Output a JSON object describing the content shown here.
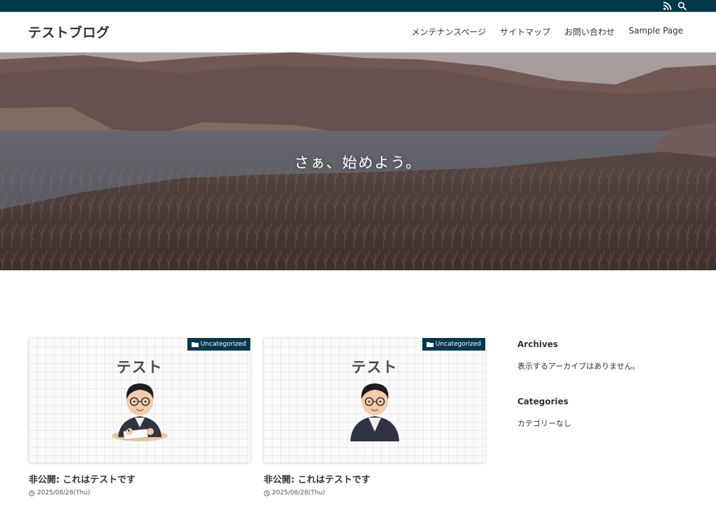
{
  "site": {
    "title": "テストブログ"
  },
  "nav": [
    {
      "label": "メンテナンスページ"
    },
    {
      "label": "サイトマップ"
    },
    {
      "label": "お問い合わせ"
    },
    {
      "label": "Sample Page"
    }
  ],
  "topbar": {
    "icons": [
      "rss-icon",
      "search-icon"
    ]
  },
  "hero": {
    "catch": "さぁ、始めよう。"
  },
  "posts": [
    {
      "category": "Uncategorized",
      "thumb_text": "テスト",
      "title": "非公開: これはテストです",
      "date": "2025/08/28(Thu)"
    },
    {
      "category": "Uncategorized",
      "thumb_text": "テスト",
      "title": "非公開: これはテストです",
      "date": "2025/08/28(Thu)"
    }
  ],
  "sidebar": {
    "archives": {
      "title": "Archives",
      "text": "表示するアーカイブはありません。"
    },
    "categories": {
      "title": "Categories",
      "text": "カテゴリーなし"
    }
  },
  "colors": {
    "topbar": "#04384c",
    "badge": "#04384c"
  }
}
